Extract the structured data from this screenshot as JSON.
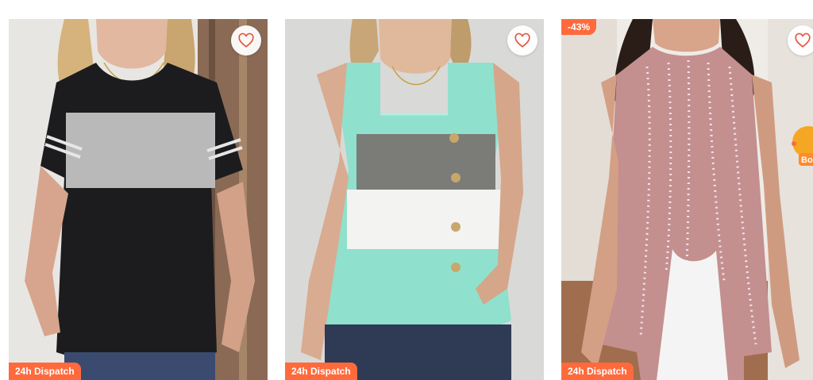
{
  "products": [
    {
      "badge": "24h Dispatch",
      "wishlist_icon": "heart-outline-icon",
      "colors": {
        "top": "#1c1c1e",
        "panel": "#b9b9b9",
        "bg": "#e9e7e4"
      }
    },
    {
      "badge": "24h Dispatch",
      "wishlist_icon": "heart-outline-icon",
      "colors": {
        "top": "#8fe0cc",
        "panel": "#7b7b78",
        "bg": "#d8d8d6"
      }
    },
    {
      "badge": "24h Dispatch",
      "discount": "-43%",
      "wishlist_icon": "heart-outline-icon",
      "colors": {
        "top": "#c48f8f",
        "bg": "#eeeae6"
      }
    }
  ],
  "promo_label": "Bo",
  "accent_color": "#ff6a3d",
  "icon_color": "#e8543e"
}
